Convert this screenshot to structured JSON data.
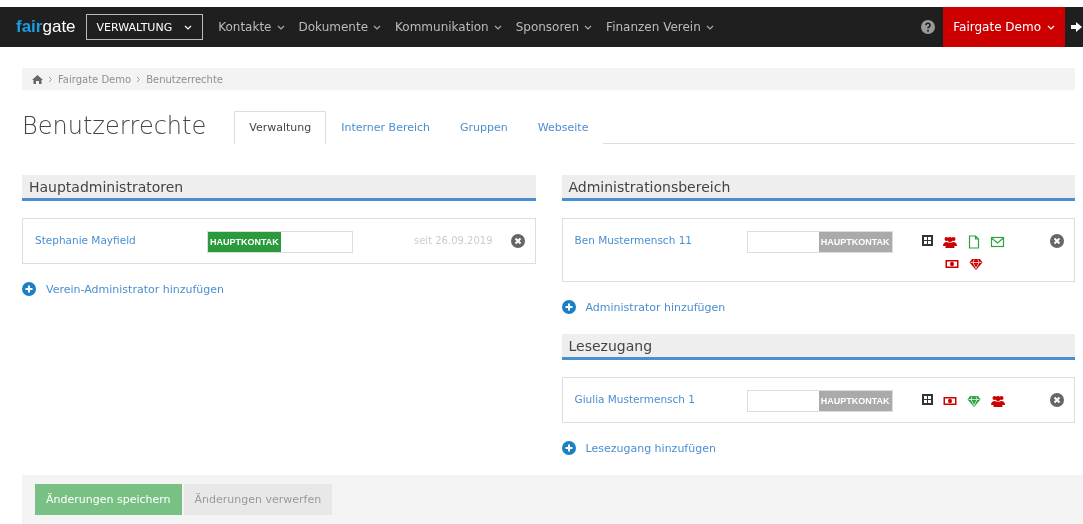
{
  "topbar": {
    "logo": {
      "accent": "fair",
      "rest": "gate"
    },
    "module": "VERWALTUNG",
    "menu": [
      "Kontakte",
      "Dokumente",
      "Kommunikation",
      "Sponsoren",
      "Finanzen Verein"
    ],
    "account": "Fairgate Demo"
  },
  "breadcrumb": [
    "Fairgate Demo",
    "Benutzerrechte"
  ],
  "title": "Benutzerrechte",
  "tabs": [
    {
      "label": "Verwaltung",
      "selected": true
    },
    {
      "label": "Interner Bereich",
      "selected": false
    },
    {
      "label": "Gruppen",
      "selected": false
    },
    {
      "label": "Webseite",
      "selected": false
    }
  ],
  "columns": [
    {
      "sections": [
        {
          "title": "Hauptadministratoren",
          "rows": [
            {
              "name": "Stephanie Mayfield",
              "switch": {
                "label": "HAUPTKONTAK",
                "on": true
              },
              "since": "seit 26.09.2019",
              "permissions": []
            }
          ],
          "add": "Verein-Administrator hinzufügen"
        }
      ]
    },
    {
      "sections": [
        {
          "title": "Administrationsbereich",
          "rows": [
            {
              "name": "Ben Mustermensch 11",
              "switch": {
                "label": "HAUPTKONTAK",
                "on": false
              },
              "permissions": [
                {
                  "kind": "expand",
                  "color": "#333333"
                },
                {
                  "kind": "users",
                  "color": "#cc0000"
                },
                {
                  "kind": "document",
                  "color": "#2ea043"
                },
                {
                  "kind": "mail",
                  "color": "#2ea043"
                },
                {
                  "kind": "money",
                  "color": "#cc0000"
                },
                {
                  "kind": "diamond",
                  "color": "#cc0000"
                }
              ]
            }
          ],
          "add": "Administrator hinzufügen"
        },
        {
          "title": "Lesezugang",
          "rows": [
            {
              "name": "Giulia Mustermensch 1",
              "switch": {
                "label": "HAUPTKONTAK",
                "on": false
              },
              "permissions": [
                {
                  "kind": "expand",
                  "color": "#333333"
                },
                {
                  "kind": "money",
                  "color": "#cc0000"
                },
                {
                  "kind": "diamond",
                  "color": "#2ea043"
                },
                {
                  "kind": "users",
                  "color": "#cc0000"
                }
              ]
            }
          ],
          "add": "Lesezugang hinzufügen"
        }
      ]
    }
  ],
  "footer": {
    "buttons": [
      {
        "label": "Änderungen speichern",
        "kind": "primary"
      },
      {
        "label": "Änderungen verwerfen",
        "kind": "secondary"
      }
    ]
  }
}
